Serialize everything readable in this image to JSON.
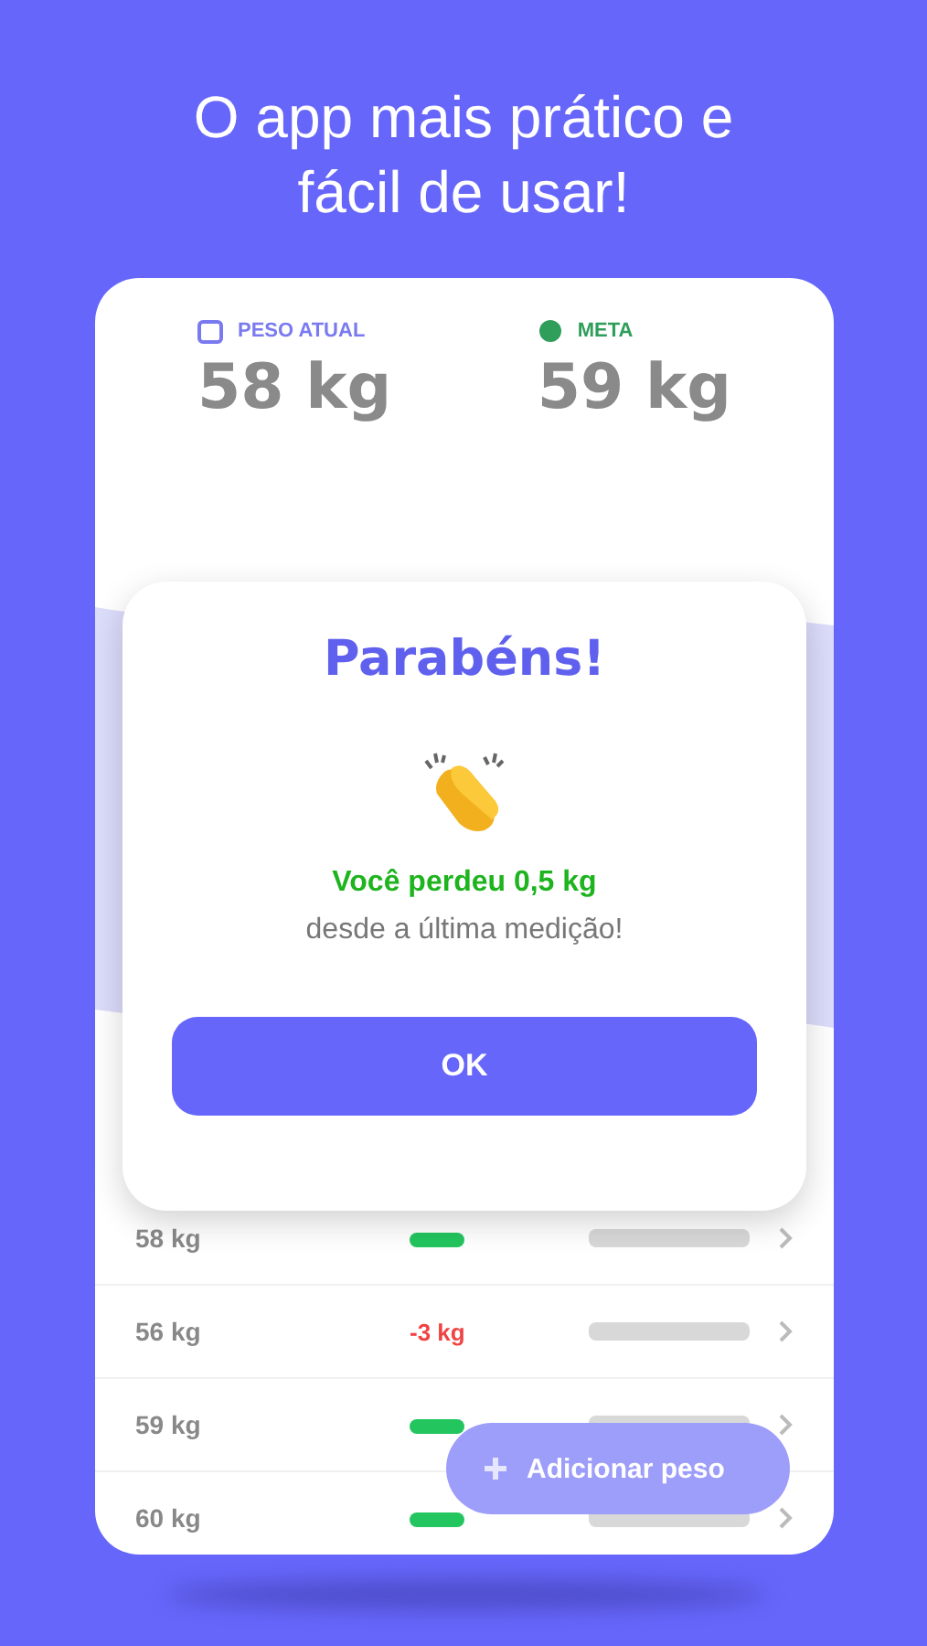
{
  "headline": "O app mais prático e fácil de usar!",
  "summary": [
    {
      "kind": "current",
      "label": "PESO ATUAL",
      "value": "58 kg"
    },
    {
      "kind": "goal",
      "label": "META",
      "value": "59 kg"
    }
  ],
  "history": [
    {
      "weight": "58 kg",
      "color": "#22c55e"
    },
    {
      "weight": "56 kg",
      "change": "-3 kg",
      "color": "#ef4444"
    },
    {
      "weight": "59 kg",
      "color": "#22c55e"
    },
    {
      "weight": "60 kg",
      "color": "#22c55e"
    }
  ],
  "add_button": {
    "label": "Adicionar peso"
  },
  "dialog": {
    "title": "Parabéns!",
    "message": "Você perdeu 0,5 kg",
    "detail": "desde a última medição!",
    "button": "OK"
  }
}
